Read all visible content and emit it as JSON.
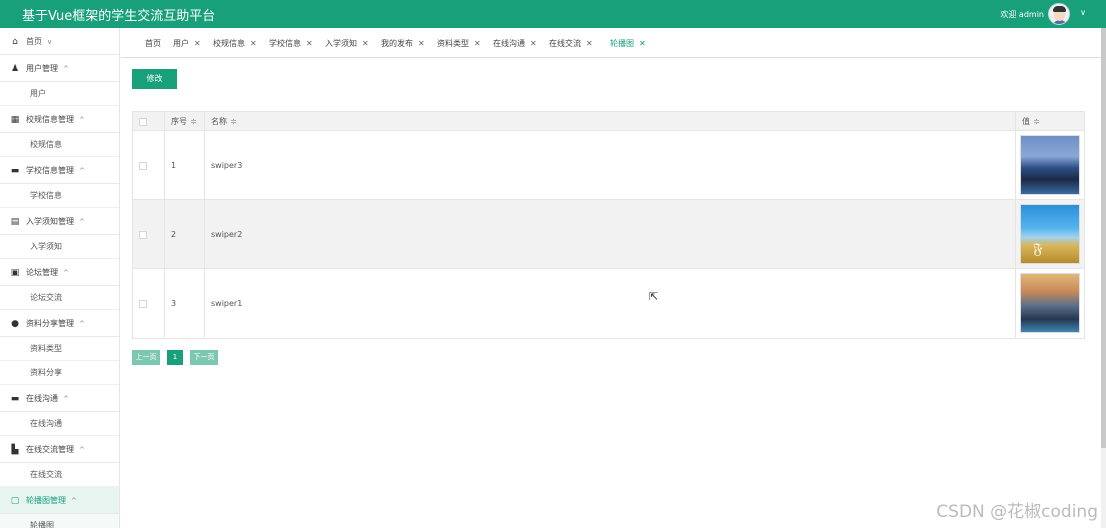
{
  "app": {
    "title": "基于Vue框架的学生交流互助平台",
    "welcome": "欢迎 admin",
    "chevron": "∨"
  },
  "sidebar": {
    "home": {
      "label": "首页",
      "caret": "∨"
    },
    "groups": [
      {
        "label": "用户管理",
        "icon": "user-icon",
        "glyph": "♟",
        "sub": [
          "用户"
        ]
      },
      {
        "label": "校规信息管理",
        "icon": "grid-icon",
        "glyph": "▦",
        "sub": [
          "校规信息"
        ]
      },
      {
        "label": "学校信息管理",
        "icon": "folder-icon",
        "glyph": "▬",
        "sub": [
          "学校信息"
        ]
      },
      {
        "label": "入学须知管理",
        "icon": "table-icon",
        "glyph": "▤",
        "sub": [
          "入学须知"
        ]
      },
      {
        "label": "论坛管理",
        "icon": "server-icon",
        "glyph": "▣",
        "sub": [
          "论坛交流"
        ]
      },
      {
        "label": "资料分享管理",
        "icon": "compass-icon",
        "glyph": "●",
        "sub": [
          "资料类型",
          "资料分享"
        ]
      },
      {
        "label": "在线沟通",
        "icon": "folder-icon",
        "glyph": "▬",
        "sub": [
          "在线沟通"
        ]
      },
      {
        "label": "在线交流管理",
        "icon": "building-icon",
        "glyph": "▙",
        "sub": [
          "在线交流"
        ]
      },
      {
        "label": "轮播图管理",
        "icon": "carousel-icon",
        "glyph": "▢",
        "sub": [
          "轮播图"
        ]
      }
    ],
    "caret_up": "^"
  },
  "tabs": [
    {
      "label": "首页",
      "closable": false
    },
    {
      "label": "用户",
      "closable": true
    },
    {
      "label": "校规信息",
      "closable": true
    },
    {
      "label": "学校信息",
      "closable": true
    },
    {
      "label": "入学须知",
      "closable": true
    },
    {
      "label": "我的发布",
      "closable": true
    },
    {
      "label": "资料类型",
      "closable": true
    },
    {
      "label": "在线沟通",
      "closable": true
    },
    {
      "label": "在线交流",
      "closable": true
    },
    {
      "label": "轮播图",
      "closable": true,
      "active": true
    }
  ],
  "toolbar": {
    "edit_label": "修改"
  },
  "table": {
    "headers": {
      "index": "序号",
      "name": "名称",
      "value": "值"
    },
    "sort_glyph": "≑",
    "rows": [
      {
        "index": "1",
        "name": "swiper3",
        "image": "city-skyline"
      },
      {
        "index": "2",
        "name": "swiper2",
        "image": "wheat-field"
      },
      {
        "index": "3",
        "name": "swiper1",
        "image": "city-night"
      }
    ]
  },
  "pager": {
    "prev": "上一页",
    "current": "1",
    "next": "下一页"
  },
  "watermark": "CSDN @花椒coding",
  "colors": {
    "accent": "#18a07a",
    "pager_disabled": "#7cc7b2"
  }
}
